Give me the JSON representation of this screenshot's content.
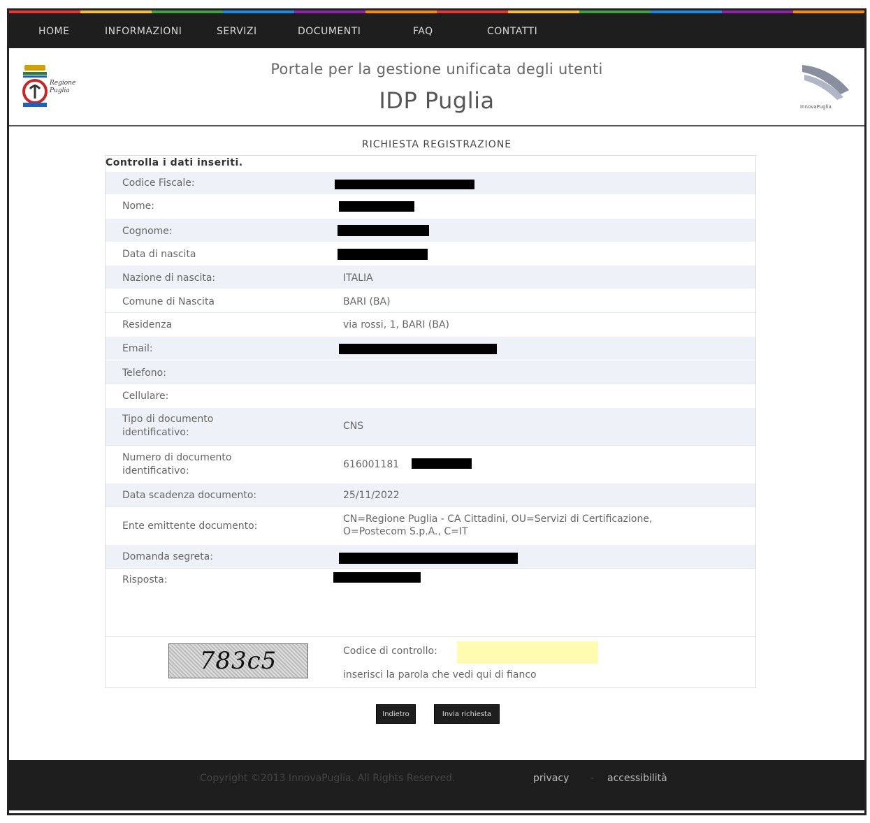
{
  "nav": {
    "items": [
      "HOME",
      "INFORMAZIONI",
      "SERVIZI",
      "DOCUMENTI",
      "FAQ",
      "CONTATTI"
    ]
  },
  "header": {
    "logo_left_text": "Regione Puglia",
    "subtitle": "Portale per la gestione unificata degli utenti",
    "title": "IDP Puglia",
    "logo_right_text": "InnovaPuglia"
  },
  "section_title": "RICHIESTA REGISTRAZIONE",
  "form": {
    "heading": "Controlla i dati inseriti.",
    "rows": [
      {
        "label": "Codice Fiscale:",
        "value": ""
      },
      {
        "label": "Nome:",
        "value": ""
      },
      {
        "label": "Cognome:",
        "value": ""
      },
      {
        "label": "Data di nascita",
        "value": ""
      },
      {
        "label": "Nazione di nascita:",
        "value": "ITALIA"
      },
      {
        "label": "Comune di Nascita",
        "value": "BARI (BA)"
      },
      {
        "label": "Residenza",
        "value": "via rossi, 1, BARI (BA)"
      },
      {
        "label": "Email:",
        "value": ""
      },
      {
        "label": "Telefono:",
        "value": ""
      },
      {
        "label": "Cellulare:",
        "value": ""
      },
      {
        "label": "Tipo di documento identificativo:",
        "value": "CNS"
      },
      {
        "label": "Numero di documento identificativo:",
        "value": "616001181"
      },
      {
        "label": "Data scadenza documento:",
        "value": "25/11/2022"
      },
      {
        "label": "Ente emittente documento:",
        "value": "CN=Regione Puglia - CA Cittadini, OU=Servizi di Certificazione, O=Postecom S.p.A., C=IT"
      },
      {
        "label": "Domanda segreta:",
        "value": ""
      },
      {
        "label": "Risposta:",
        "value": ""
      }
    ],
    "captcha": {
      "image_text": "783c5",
      "label": "Codice di controllo:",
      "hint": "inserisci la parola che vedi qui di fianco",
      "value": ""
    }
  },
  "buttons": {
    "back": "Indietro",
    "submit": "Invia richiesta"
  },
  "footer": {
    "copyright": "Copyright ©2013 InnovaPuglia. All Rights Reserved.",
    "privacy": "privacy",
    "separator": "-",
    "accessibility": "accessibilità"
  },
  "colors": {
    "nav_bg": "#1e1e1e",
    "row_alt_bg": "#eef2f8",
    "captcha_input_bg": "#fffbb0",
    "colorbar": [
      "#e53935",
      "#fbc02d",
      "#43a047",
      "#1e88e5",
      "#8e24aa",
      "#fb8c00",
      "#e53935",
      "#fbc02d",
      "#43a047",
      "#1e88e5",
      "#8e24aa",
      "#fb8c00"
    ]
  }
}
